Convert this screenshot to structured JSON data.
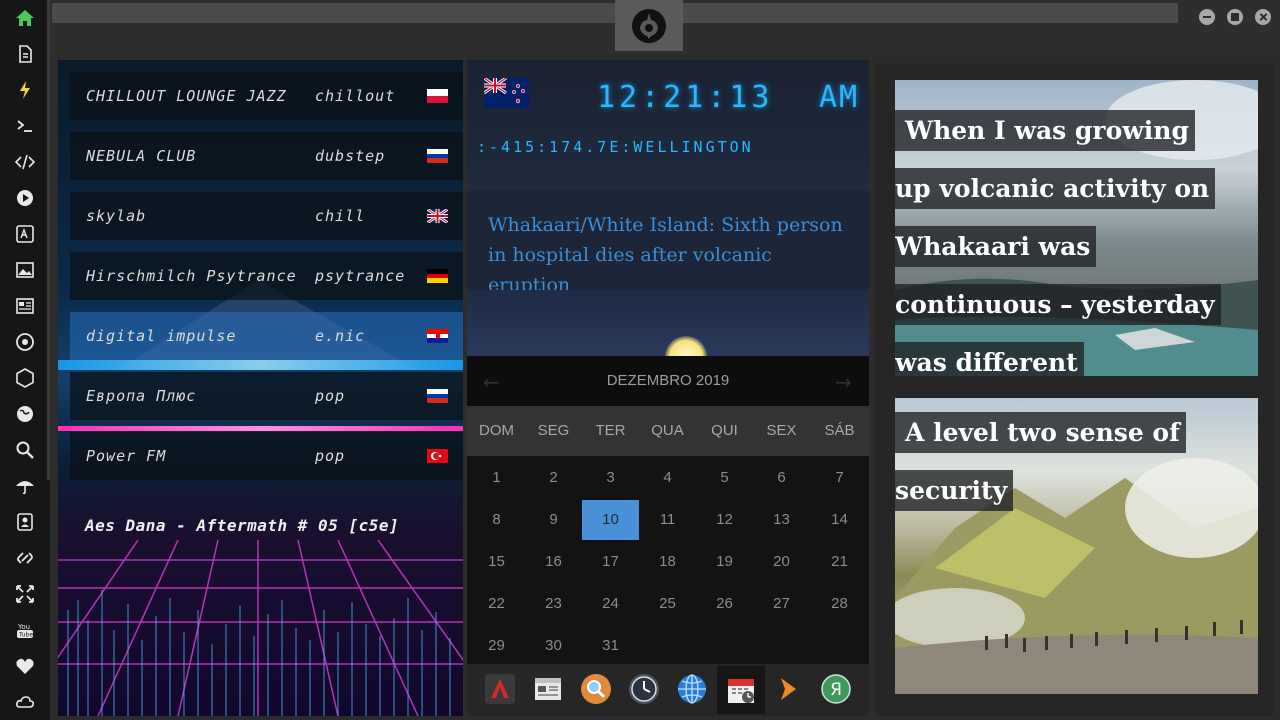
{
  "sidebar": {
    "icons": [
      "home-icon",
      "document-icon",
      "bolt-icon",
      "terminal-icon",
      "code-icon",
      "play-icon",
      "translate-icon",
      "image-icon",
      "news-icon",
      "settings-icon",
      "hexagon-icon",
      "globe-icon",
      "search-icon",
      "umbrella-icon",
      "contacts-icon",
      "link-icon",
      "fullscreen-icon",
      "youtube-icon",
      "heart-icon",
      "cloud-icon"
    ]
  },
  "radio": {
    "stations": [
      {
        "name": "CHILLOUT LOUNGE JAZZ",
        "genre": "chillout",
        "flag": "pl"
      },
      {
        "name": "NEBULA CLUB",
        "genre": "dubstep",
        "flag": "ru"
      },
      {
        "name": "skylab",
        "genre": "chill",
        "flag": "gb"
      },
      {
        "name": "Hirschmilch Psytrance",
        "genre": "psytrance",
        "flag": "de"
      },
      {
        "name": "digital impulse",
        "genre": "e.nic",
        "flag": "hr"
      },
      {
        "name": "Европа Плюс",
        "genre": "pop",
        "flag": "ru"
      },
      {
        "name": "Power FM",
        "genre": "pop",
        "flag": "tr"
      }
    ],
    "now_playing": "Aes Dana - Aftermath # 05 [c5e]"
  },
  "clock": {
    "time": "12:21:13",
    "ampm": "AM",
    "coords": ":-415:174.7E:WELLINGTON",
    "headline": "Whakaari/White Island: Sixth person in hospital dies after volcanic eruption"
  },
  "calendar": {
    "title": "DEZEMBRO 2019",
    "prev": "←",
    "next": "→",
    "weekdays": [
      "DOM",
      "SEG",
      "TER",
      "QUA",
      "QUI",
      "SEX",
      "SÁB"
    ],
    "weeks": [
      [
        "1",
        "2",
        "3",
        "4",
        "5",
        "6",
        "7"
      ],
      [
        "8",
        "9",
        "10",
        "11",
        "12",
        "13",
        "14"
      ],
      [
        "15",
        "16",
        "17",
        "18",
        "19",
        "20",
        "21"
      ],
      [
        "22",
        "23",
        "24",
        "25",
        "26",
        "27",
        "28"
      ],
      [
        "29",
        "30",
        "31",
        "",
        "",
        "",
        ""
      ]
    ],
    "today": "10"
  },
  "dock": {
    "items": [
      "app-launcher-icon",
      "calculator-icon",
      "search-app-icon",
      "clock-app-icon",
      "browser-icon",
      "calendar-app-icon",
      "forward-icon",
      "yandex-icon"
    ],
    "yandex_letter": "Я"
  },
  "news": {
    "cards": [
      {
        "lines": [
          "When I was growing",
          "up volcanic activity on",
          "Whakaari was",
          "continuous – yesterday",
          "was different"
        ]
      },
      {
        "lines": [
          "A level two sense of",
          "security"
        ]
      }
    ]
  }
}
